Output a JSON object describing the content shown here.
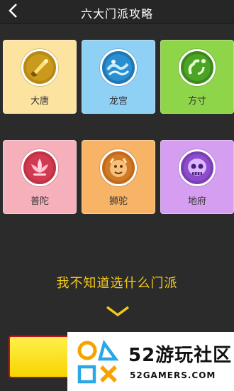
{
  "header": {
    "title": "六大门派攻略",
    "back_icon": "chevron-left-icon"
  },
  "sects": [
    {
      "label": "大唐",
      "icon": "sword-emblem-icon",
      "bg": "#fde3a0",
      "ring": "#b78a16"
    },
    {
      "label": "龙宫",
      "icon": "wave-emblem-icon",
      "bg": "#8fd1f4",
      "ring": "#1d78b5"
    },
    {
      "label": "方寸",
      "icon": "cloud-emblem-icon",
      "bg": "#8ed54a",
      "ring": "#3d8a1c"
    },
    {
      "label": "普陀",
      "icon": "lotus-emblem-icon",
      "bg": "#f6b0bb",
      "ring": "#c23144"
    },
    {
      "label": "狮驼",
      "icon": "lion-emblem-icon",
      "bg": "#f7b467",
      "ring": "#c36a1a"
    },
    {
      "label": "地府",
      "icon": "skull-emblem-icon",
      "bg": "#d59ef0",
      "ring": "#7b3fb5"
    }
  ],
  "prompt": {
    "text": "我不知道选什么门派",
    "color": "#f5c916"
  },
  "watermark": {
    "title": "52游玩社区",
    "url": "52GAMERS.COM"
  }
}
